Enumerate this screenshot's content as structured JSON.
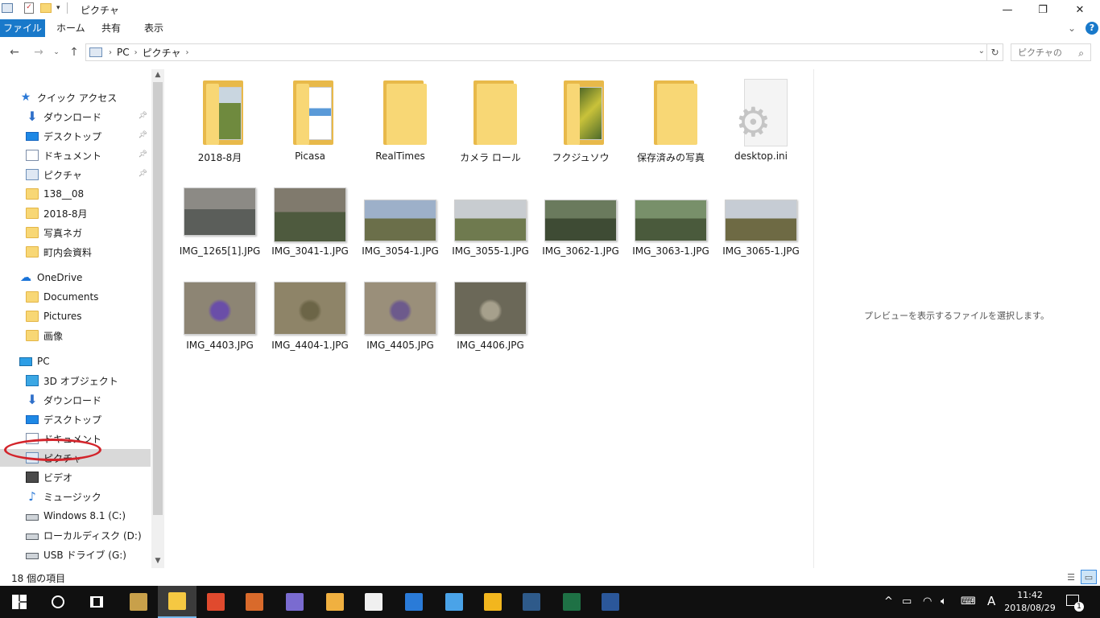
{
  "window": {
    "title": "ピクチャ",
    "minimize": "—",
    "maximize": "❐",
    "close": "✕"
  },
  "ribbon": {
    "tabs": [
      "ファイル",
      "ホーム",
      "共有",
      "表示"
    ],
    "help": "?",
    "expand": "⌄"
  },
  "address": {
    "crumbs": [
      "PC",
      "ピクチャ"
    ],
    "search_placeholder": "ピクチャの"
  },
  "sidebar": {
    "items": [
      {
        "label": "クイック アクセス",
        "icon": "star-icon",
        "pinned": false
      },
      {
        "label": "ダウンロード",
        "icon": "download-icon",
        "pinned": true
      },
      {
        "label": "デスクトップ",
        "icon": "desktop-icon",
        "pinned": true
      },
      {
        "label": "ドキュメント",
        "icon": "document-icon",
        "pinned": true
      },
      {
        "label": "ピクチャ",
        "icon": "pictures-icon",
        "pinned": true
      },
      {
        "label": "138__08",
        "icon": "folder-icon",
        "pinned": false
      },
      {
        "label": "2018-8月",
        "icon": "folder-icon",
        "pinned": false
      },
      {
        "label": "写真ネガ",
        "icon": "folder-icon",
        "pinned": false
      },
      {
        "label": "町内会資料",
        "icon": "folder-icon",
        "pinned": false
      },
      {
        "label": "OneDrive",
        "icon": "cloud-icon",
        "pinned": false
      },
      {
        "label": "Documents",
        "icon": "folder-icon",
        "pinned": false
      },
      {
        "label": "Pictures",
        "icon": "folder-icon",
        "pinned": false
      },
      {
        "label": "画像",
        "icon": "folder-icon",
        "pinned": false
      },
      {
        "label": "PC",
        "icon": "pc-icon",
        "pinned": false
      },
      {
        "label": "3D オブジェクト",
        "icon": "3d-objects-icon",
        "pinned": false
      },
      {
        "label": "ダウンロード",
        "icon": "download-icon",
        "pinned": false
      },
      {
        "label": "デスクトップ",
        "icon": "desktop-icon",
        "pinned": false
      },
      {
        "label": "ドキュメント",
        "icon": "document-icon",
        "pinned": false
      },
      {
        "label": "ピクチャ",
        "icon": "pictures-icon",
        "pinned": false,
        "selected": true
      },
      {
        "label": "ビデオ",
        "icon": "video-icon",
        "pinned": false
      },
      {
        "label": "ミュージック",
        "icon": "music-icon",
        "pinned": false
      },
      {
        "label": "Windows 8.1 (C:)",
        "icon": "drive-icon",
        "pinned": false
      },
      {
        "label": "ローカルディスク (D:)",
        "icon": "drive-icon",
        "pinned": false
      },
      {
        "label": "USB ドライブ (G:)",
        "icon": "usb-drive-icon",
        "pinned": false
      }
    ]
  },
  "content": {
    "folders": [
      {
        "label": "2018-8月",
        "thumb": "landscape"
      },
      {
        "label": "Picasa",
        "thumb": "document"
      },
      {
        "label": "RealTimes",
        "thumb": "none"
      },
      {
        "label": "カメラ ロール",
        "thumb": "none"
      },
      {
        "label": "フクジュソウ",
        "thumb": "plant"
      },
      {
        "label": "保存済みの写真",
        "thumb": "none"
      },
      {
        "label": "desktop.ini",
        "thumb": "settings-file"
      }
    ],
    "photos_row1": [
      {
        "label": "IMG_1265[1].JPG",
        "colors": [
          "#8c8a85",
          "#5b5e5a"
        ]
      },
      {
        "label": "IMG_3041-1.JPG",
        "colors": [
          "#807a6d",
          "#4e5a3e"
        ]
      },
      {
        "label": "IMG_3054-1.JPG",
        "colors": [
          "#9db0c9",
          "#6b6f4a"
        ]
      },
      {
        "label": "IMG_3055-1.JPG",
        "colors": [
          "#c8ccd0",
          "#6f7a4f"
        ]
      },
      {
        "label": "IMG_3062-1.JPG",
        "colors": [
          "#6a7a5d",
          "#3e4b34"
        ]
      },
      {
        "label": "IMG_3063-1.JPG",
        "colors": [
          "#78906a",
          "#4a5a3c"
        ]
      },
      {
        "label": "IMG_3065-1.JPG",
        "colors": [
          "#c6ccd4",
          "#6e6a44"
        ]
      }
    ],
    "photos_row2": [
      {
        "label": "IMG_4403.JPG",
        "colors": [
          "#8d8574",
          "#6a4ea8"
        ]
      },
      {
        "label": "IMG_4404-1.JPG",
        "colors": [
          "#8e8468",
          "#6c6547"
        ]
      },
      {
        "label": "IMG_4405.JPG",
        "colors": [
          "#9a8f7a",
          "#6d5a8c"
        ]
      },
      {
        "label": "IMG_4406.JPG",
        "colors": [
          "#6b6858",
          "#a6a08c"
        ]
      }
    ]
  },
  "preview": {
    "message": "プレビューを表示するファイルを選択します。"
  },
  "status": {
    "item_count": "18 個の項目"
  },
  "taskbar": {
    "apps": [
      {
        "name": "start-icon"
      },
      {
        "name": "search-icon"
      },
      {
        "name": "task-view-icon"
      },
      {
        "name": "photo-app-icon",
        "color": "#c8a04a"
      },
      {
        "name": "file-explorer-icon",
        "color": "#f5c842",
        "active": true
      },
      {
        "name": "store-icon",
        "color": "#e04a2e"
      },
      {
        "name": "toolbox-icon",
        "color": "#d96a2b"
      },
      {
        "name": "paint-icon",
        "color": "#7a6bd0"
      },
      {
        "name": "palette-icon",
        "color": "#f0b040"
      },
      {
        "name": "sticky-notes-icon",
        "color": "#f0f0f0"
      },
      {
        "name": "edge-icon",
        "color": "#2a7bd8"
      },
      {
        "name": "ie-icon",
        "color": "#4aa3e8"
      },
      {
        "name": "app-yellow-icon",
        "color": "#f2b61e"
      },
      {
        "name": "app-dark-icon",
        "color": "#2e5a8a"
      },
      {
        "name": "excel-icon",
        "color": "#1e7145"
      },
      {
        "name": "word-icon",
        "color": "#2b579a"
      }
    ],
    "ime": "A",
    "time": "11:42",
    "date": "2018/08/29",
    "notifications": "1"
  },
  "colors": {
    "accent": "#1979ca",
    "selection": "#d9d9d9",
    "annotation": "#d3242b"
  }
}
